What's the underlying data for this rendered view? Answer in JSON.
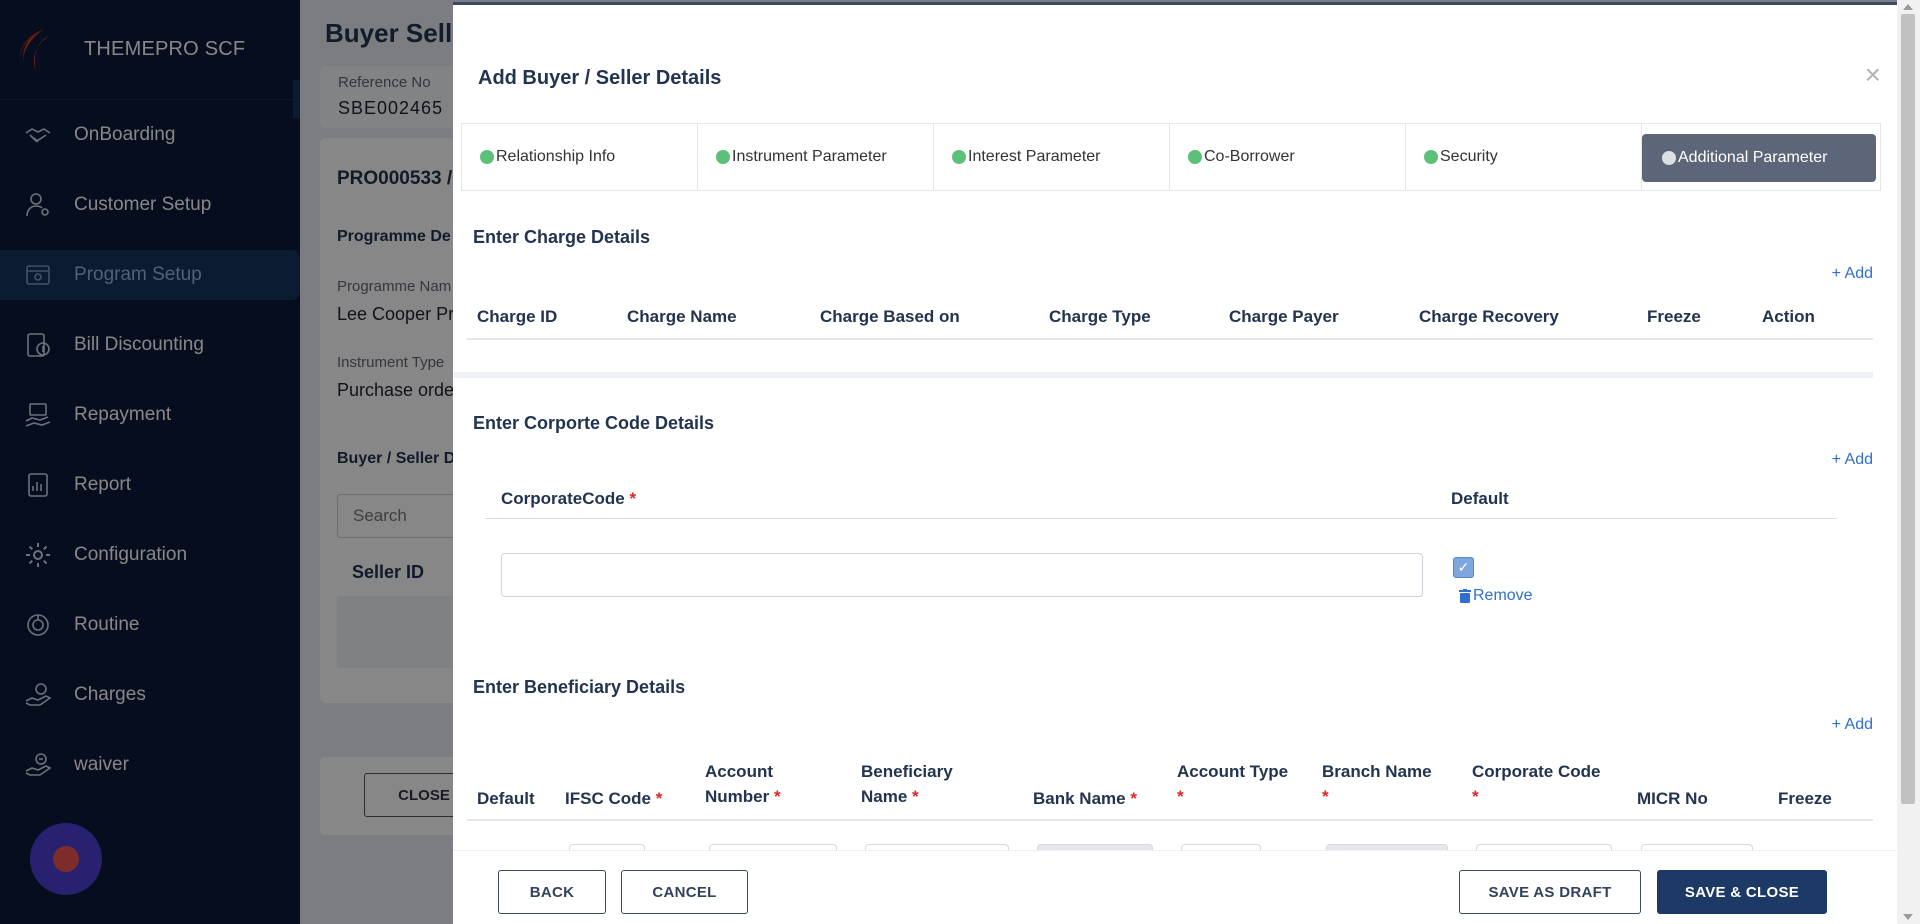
{
  "brand": {
    "name": "THEMEPRO SCF"
  },
  "sidebar": {
    "items": [
      {
        "label": "OnBoarding",
        "icon": "handshake-icon"
      },
      {
        "label": "Customer Setup",
        "icon": "user-settings-icon"
      },
      {
        "label": "Program Setup",
        "icon": "program-icon",
        "active": true
      },
      {
        "label": "Bill Discounting",
        "icon": "bill-icon"
      },
      {
        "label": "Repayment",
        "icon": "repayment-icon"
      },
      {
        "label": "Report",
        "icon": "report-icon"
      },
      {
        "label": "Configuration",
        "icon": "gear-icon"
      },
      {
        "label": "Routine",
        "icon": "routine-icon"
      },
      {
        "label": "Charges",
        "icon": "charges-icon"
      },
      {
        "label": "waiver",
        "icon": "waiver-icon"
      }
    ]
  },
  "background_page": {
    "title": "Buyer Selle",
    "reference_label": "Reference No",
    "reference_value": "SBE002465",
    "program_code": "PRO000533 /",
    "programme_details": "Programme De",
    "programme_name_label": "Programme Nam",
    "programme_name_value": "Lee Cooper Pro",
    "instrument_type_label": "Instrument Type",
    "instrument_type_value": "Purchase order",
    "buyer_seller_label": "Buyer / Seller D",
    "search_placeholder": "Search",
    "seller_id_header": "Seller ID",
    "close_label": "CLOSE"
  },
  "modal": {
    "title": "Add Buyer / Seller Details",
    "close_symbol": "×",
    "tabs": [
      {
        "label": "Relationship Info"
      },
      {
        "label": "Instrument Parameter"
      },
      {
        "label": "Interest Parameter"
      },
      {
        "label": "Co-Borrower"
      },
      {
        "label": "Security"
      },
      {
        "label": "Additional Parameter",
        "active": true
      }
    ],
    "charge_section": {
      "title": "Enter Charge Details",
      "add_label": "+ Add",
      "columns": [
        "Charge ID",
        "Charge Name",
        "Charge Based on",
        "Charge Type",
        "Charge Payer",
        "Charge Recovery",
        "Freeze",
        "Action"
      ]
    },
    "corporate_section": {
      "title": "Enter Corporte Code Details",
      "add_label": "+ Add",
      "col_code": "CorporateCode",
      "col_default": "Default",
      "required_mark": "*",
      "row_value": "",
      "default_checked": true,
      "remove_label": "Remove"
    },
    "beneficiary_section": {
      "title": "Enter Beneficiary Details",
      "add_label": "+ Add",
      "columns": [
        {
          "line1": "Default",
          "line2": "",
          "required": false
        },
        {
          "line1": "IFSC Code",
          "line2": "",
          "required": true
        },
        {
          "line1": "Account",
          "line2": "Number",
          "required": true
        },
        {
          "line1": "Beneficiary",
          "line2": "Name",
          "required": true
        },
        {
          "line1": "Bank Name",
          "line2": "",
          "required": true
        },
        {
          "line1": "Account Type",
          "line2": "",
          "required": true
        },
        {
          "line1": "Branch Name",
          "line2": "",
          "required": true
        },
        {
          "line1": "Corporate Code",
          "line2": "",
          "required": true
        },
        {
          "line1": "MICR No",
          "line2": "",
          "required": false
        },
        {
          "line1": "Freeze",
          "line2": "",
          "required": false
        }
      ]
    },
    "footer": {
      "back": "BACK",
      "cancel": "CANCEL",
      "save_draft": "SAVE AS DRAFT",
      "save_close": "SAVE & CLOSE"
    }
  },
  "colors": {
    "sidebar_bg": "#0b1a3a",
    "active_tab": "#5d6678",
    "primary_button": "#1d3a66",
    "link": "#2f6fd0",
    "required": "#e02424",
    "tab_dot": "#5cc079"
  }
}
